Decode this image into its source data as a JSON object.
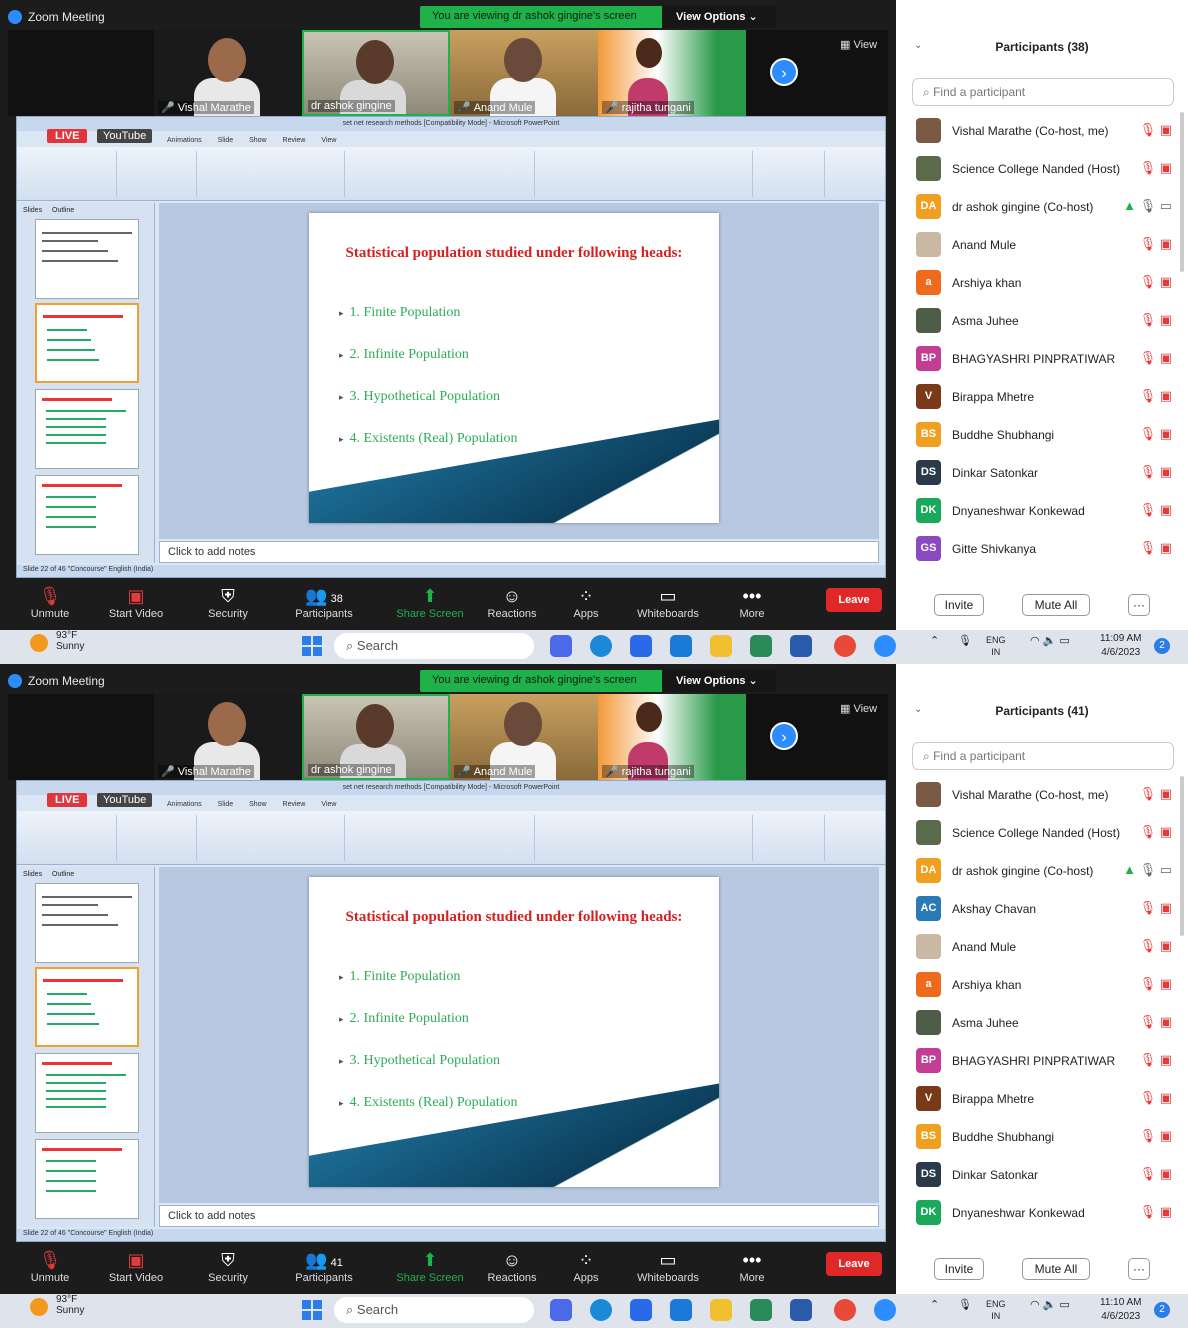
{
  "colors": {
    "zoom_blue": "#2d8cff",
    "share_green": "#1fb14a",
    "leave_red": "#e02828",
    "slide_heading": "#d52121",
    "slide_bullets": "#2cab56"
  },
  "window_title": "Zoom Meeting",
  "banner_text": "You are viewing dr ashok gingine's screen",
  "view_options_label": "View Options",
  "view_label": "View",
  "live_label": "LIVE",
  "youtube_label": "YouTube",
  "ppt_title": "set net research methods [Compatibility Mode] - Microsoft PowerPoint",
  "ribbon_tabs": "Animations Slide Show Review View",
  "thumb_tabs": "Slides Outline",
  "ppt_status": "Slide 22 of 46   \"Concourse\"   English (India)",
  "notes_placeholder": "Click to add notes",
  "slide": {
    "heading": "Statistical population studied under following heads:",
    "bullets": [
      "1. Finite Population",
      "2. Infinite Population",
      "3. Hypothetical Population",
      "4. Existents (Real) Population"
    ]
  },
  "toolbar": {
    "unmute": "Unmute",
    "start_video": "Start Video",
    "security": "Security",
    "participants": "Participants",
    "share_screen": "Share Screen",
    "reactions": "Reactions",
    "apps": "Apps",
    "whiteboards": "Whiteboards",
    "more": "More",
    "leave": "Leave"
  },
  "participants_search_placeholder": "Find a participant",
  "invite_label": "Invite",
  "mute_all_label": "Mute All",
  "more_label": "···",
  "taskbar": {
    "temp": "93°F",
    "weather": "Sunny",
    "search": "Search",
    "lang": "ENG",
    "region": "IN",
    "date": "4/6/2023"
  },
  "sessions": [
    {
      "video_tiles": [
        "Vishal Marathe",
        "dr ashok gingine",
        "Anand Mule",
        "rajitha tungani"
      ],
      "participants_title": "Participants (38)",
      "participant_count": "38",
      "time": "11:09 AM",
      "participants": [
        {
          "initials": "",
          "name": "Vishal Marathe (Co-host, me)",
          "color": "#7a5a44"
        },
        {
          "initials": "",
          "name": "Science College Nanded (Host)",
          "color": "#5a6a4a"
        },
        {
          "initials": "DA",
          "name": "dr ashok gingine (Co-host)",
          "color": "#f0a020"
        },
        {
          "initials": "",
          "name": "Anand Mule",
          "color": "#c9b9a4"
        },
        {
          "initials": "a",
          "name": "Arshiya khan",
          "color": "#f06a1c"
        },
        {
          "initials": "",
          "name": "Asma Juhee",
          "color": "#4d5d48"
        },
        {
          "initials": "BP",
          "name": "BHAGYASHRI PINPRATIWAR",
          "color": "#c23d93"
        },
        {
          "initials": "V",
          "name": "Birappa Mhetre",
          "color": "#7a3a1a"
        },
        {
          "initials": "BS",
          "name": "Buddhe Shubhangi",
          "color": "#f0a020"
        },
        {
          "initials": "DS",
          "name": "Dinkar Satonkar",
          "color": "#2a3a4a"
        },
        {
          "initials": "DK",
          "name": "Dnyaneshwar Konkewad",
          "color": "#1aa85a"
        },
        {
          "initials": "GS",
          "name": "Gitte Shivkanya",
          "color": "#8a4ac2"
        }
      ]
    },
    {
      "video_tiles": [
        "Vishal Marathe",
        "dr ashok gingine",
        "Anand Mule",
        "rajitha tungani"
      ],
      "participants_title": "Participants (41)",
      "participant_count": "41",
      "time": "11:10 AM",
      "participants": [
        {
          "initials": "",
          "name": "Vishal Marathe (Co-host, me)",
          "color": "#7a5a44"
        },
        {
          "initials": "",
          "name": "Science College Nanded (Host)",
          "color": "#5a6a4a"
        },
        {
          "initials": "DA",
          "name": "dr ashok gingine (Co-host)",
          "color": "#f0a020"
        },
        {
          "initials": "AC",
          "name": "Akshay Chavan",
          "color": "#2a7ab8"
        },
        {
          "initials": "",
          "name": "Anand Mule",
          "color": "#c9b9a4"
        },
        {
          "initials": "a",
          "name": "Arshiya khan",
          "color": "#f06a1c"
        },
        {
          "initials": "",
          "name": "Asma Juhee",
          "color": "#4d5d48"
        },
        {
          "initials": "BP",
          "name": "BHAGYASHRI PINPRATIWAR",
          "color": "#c23d93"
        },
        {
          "initials": "V",
          "name": "Birappa Mhetre",
          "color": "#7a3a1a"
        },
        {
          "initials": "BS",
          "name": "Buddhe Shubhangi",
          "color": "#f0a020"
        },
        {
          "initials": "DS",
          "name": "Dinkar Satonkar",
          "color": "#2a3a4a"
        },
        {
          "initials": "DK",
          "name": "Dnyaneshwar Konkewad",
          "color": "#1aa85a"
        }
      ]
    }
  ]
}
